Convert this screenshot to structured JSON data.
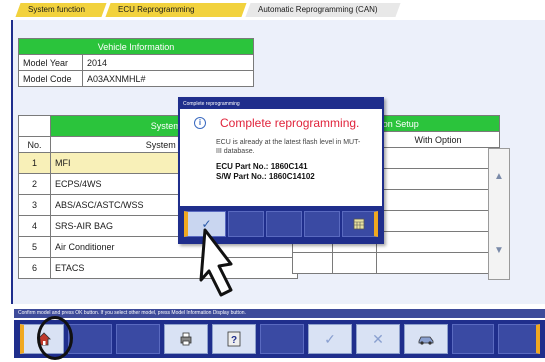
{
  "breadcrumb": {
    "items": [
      "System function",
      "ECU Reprogramming",
      "Automatic Reprogramming (CAN)"
    ]
  },
  "vehicle_info": {
    "header": "Vehicle Information",
    "rows": [
      {
        "label": "Model Year",
        "value": "2014"
      },
      {
        "label": "Model Code",
        "value": "A03AXNMHL#"
      }
    ]
  },
  "system_list": {
    "header": "System List",
    "col_no": "No.",
    "col_name": "System Name",
    "rows": [
      {
        "no": "1",
        "name": "MFI"
      },
      {
        "no": "2",
        "name": "ECPS/4WS"
      },
      {
        "no": "3",
        "name": "ABS/ASC/ASTC/WSS"
      },
      {
        "no": "4",
        "name": "SRS-AIR BAG"
      },
      {
        "no": "5",
        "name": "Air Conditioner"
      },
      {
        "no": "6",
        "name": "ETACS"
      }
    ]
  },
  "option_setup": {
    "header": "ption Setup",
    "col_name": "me",
    "col_option": "With Option"
  },
  "hint_text": "Confirm model and press OK button. If you select other model, press Model Information Display button.",
  "dialog": {
    "title_bar": "Complete reprogramming",
    "title": "Complete reprogramming.",
    "message": "ECU is already at the latest flash level in MUT-III database.",
    "ecu_part_label": "ECU Part No.:",
    "ecu_part_value": "1860C141",
    "sw_part_label": "S/W Part No.:",
    "sw_part_value": "1860C14102"
  },
  "icons": {
    "home": "home-icon",
    "print": "print-icon",
    "help": "help-icon",
    "ok": "checkmark-icon",
    "cancel": "cancel-icon",
    "vehicle": "vehicle-icon",
    "calendar": "calendar-icon",
    "info": "info-icon",
    "cursor": "hand-cursor-icon"
  },
  "colors": {
    "accent_navy": "#1f2e8c",
    "header_green": "#2bc43c",
    "tab_yellow": "#f2d23d",
    "title_red": "#e0243c",
    "highlight_gold": "#f0a820"
  }
}
